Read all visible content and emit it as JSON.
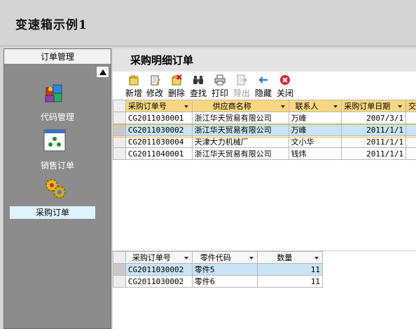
{
  "app": {
    "title": "变速箱示例1"
  },
  "sidebar": {
    "header": "订单管理",
    "items": [
      {
        "label": "代码管理",
        "icon": "code-management-icon"
      },
      {
        "label": "销售订单",
        "icon": "sales-order-icon"
      },
      {
        "label": "采购订单",
        "icon": "purchase-order-icon",
        "selected": true
      }
    ]
  },
  "main": {
    "title": "采购明细订单",
    "toolbar": [
      {
        "label": "新增",
        "icon": "new-icon",
        "enabled": true
      },
      {
        "label": "修改",
        "icon": "edit-icon",
        "enabled": true
      },
      {
        "label": "删除",
        "icon": "delete-icon",
        "enabled": true
      },
      {
        "label": "查找",
        "icon": "find-binoculars-icon",
        "enabled": true
      },
      {
        "label": "打印",
        "icon": "print-icon",
        "enabled": true
      },
      {
        "label": "导出",
        "icon": "export-icon",
        "enabled": false
      },
      {
        "label": "隐藏",
        "icon": "hide-arrow-icon",
        "enabled": true
      },
      {
        "label": "关闭",
        "icon": "close-icon",
        "enabled": true
      }
    ]
  },
  "orders": {
    "columns": [
      "采购订单号",
      "供应商名称",
      "联系人",
      "采购订单日期",
      "交"
    ],
    "rows": [
      [
        "CG2011030001",
        "浙江华天贸易有限公司",
        "万峰",
        "2007/3/1",
        ""
      ],
      [
        "CG2011030002",
        "浙江华天贸易有限公司",
        "万峰",
        "2011/1/1",
        ""
      ],
      [
        "CG2011030004",
        "天津大力机械厂",
        "文小华",
        "2011/1/1",
        ""
      ],
      [
        "CG2011040001",
        "浙江华天贸易有限公司",
        "钱炜",
        "2011/1/1",
        ""
      ]
    ],
    "active_row": 1
  },
  "details": {
    "columns": [
      "采购订单号",
      "零件代码",
      "数量"
    ],
    "rows": [
      [
        "CG2011030002",
        "零件5",
        "11"
      ],
      [
        "CG2011030002",
        "零件6",
        "11"
      ]
    ],
    "active_row": 0
  }
}
